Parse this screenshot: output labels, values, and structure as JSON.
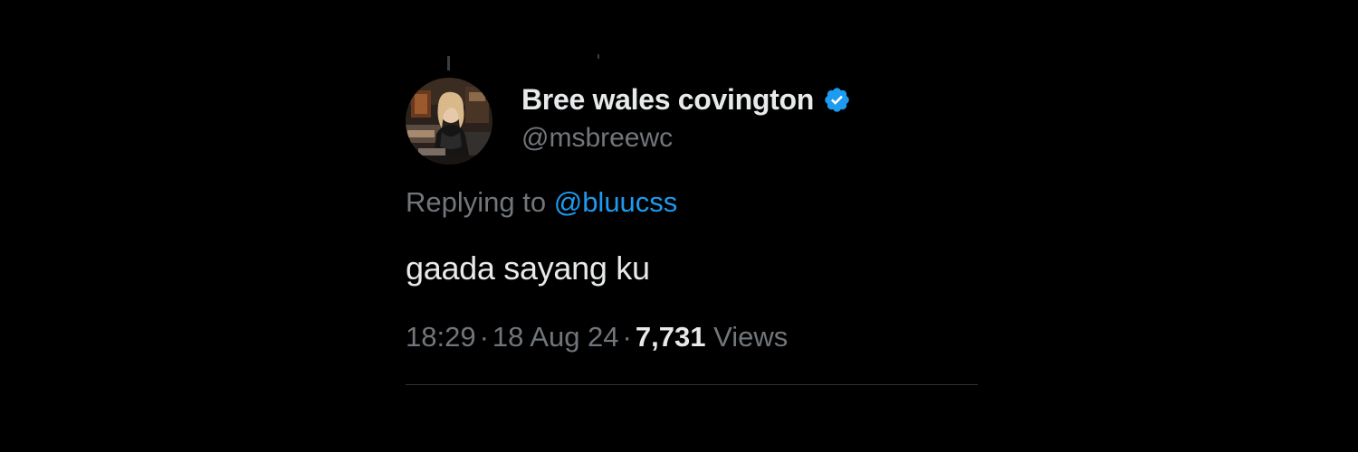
{
  "tweet": {
    "author": {
      "display_name": "Bree wales covington",
      "handle": "@msbreewc",
      "verified": true,
      "avatar_icon": "profile-photo"
    },
    "reply": {
      "prefix": "Replying to",
      "to_handle": "@bluucss"
    },
    "text": "gaada sayang ku",
    "meta": {
      "time": "18:29",
      "date": "18 Aug 24",
      "separator": "·",
      "views_count": "7,731",
      "views_label": "Views"
    }
  },
  "colors": {
    "background": "#000000",
    "primary_text": "#e7e9ea",
    "secondary_text": "#71767b",
    "link": "#1d9bf0",
    "verified_badge": "#1d9bf0",
    "divider": "#2f3336"
  }
}
